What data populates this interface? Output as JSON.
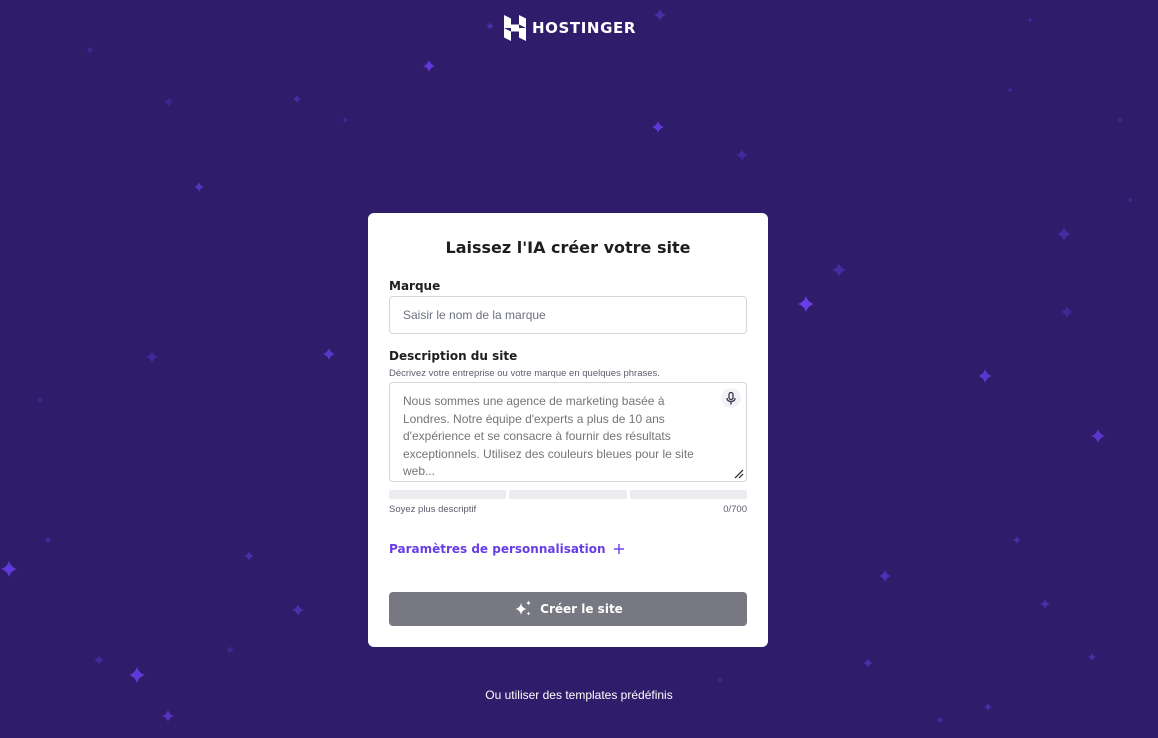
{
  "brand": {
    "name": "HOSTINGER",
    "icon": "hostinger-logo-icon"
  },
  "colors": {
    "background": "#2f1c6a",
    "accent": "#673de6",
    "star": "#673de6",
    "button_disabled": "#787883"
  },
  "form": {
    "title": "Laissez l'IA créer votre site",
    "brand_label": "Marque",
    "brand_placeholder": "Saisir le nom de la marque",
    "brand_value": "",
    "description_label": "Description du site",
    "description_hint": "Décrivez votre entreprise ou votre marque en quelques phrases.",
    "description_placeholder": "Nous sommes une agence de marketing basée à Londres. Notre équipe d'experts a plus de 10 ans d'expérience et se consacre à fournir des résultats exceptionnels. Utilisez des couleurs bleues pour le site web...",
    "description_value": "",
    "mic_icon": "microphone-icon",
    "strength_levels": [
      0,
      0,
      0
    ],
    "strength_label": "Soyez plus descriptif",
    "char_counter": "0/700",
    "customization_label": "Paramètres de personnalisation",
    "customization_icon": "plus-icon",
    "submit_label": "Créer le site",
    "submit_icon": "sparkles-icon"
  },
  "footer": {
    "templates_link": "Ou utiliser des templates prédéfinis"
  }
}
